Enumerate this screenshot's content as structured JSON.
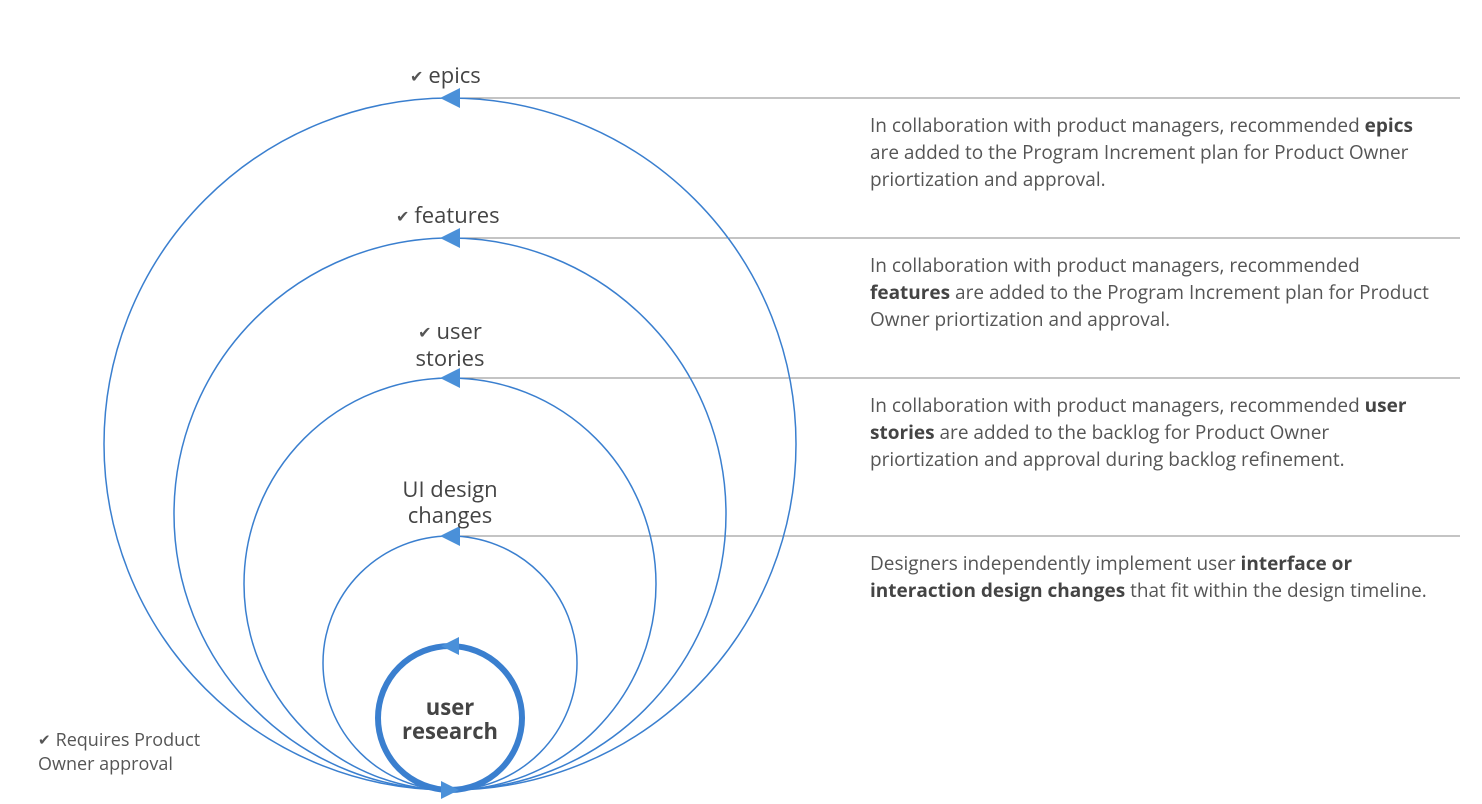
{
  "center": {
    "label_line1": "user",
    "label_line2": "research"
  },
  "rings": {
    "ui": {
      "has_check": false,
      "label_line1": "UI design",
      "label_line2": "changes"
    },
    "stories": {
      "has_check": true,
      "label_line1": "user",
      "label_line2": "stories"
    },
    "features": {
      "has_check": true,
      "label_line1": "features",
      "label_line2": ""
    },
    "epics": {
      "has_check": true,
      "label_line1": "epics",
      "label_line2": ""
    }
  },
  "descriptions": {
    "epics": {
      "pre": "In collaboration with product managers, recommended ",
      "bold": "epics",
      "post": " are added to the Program Increment plan for Product Owner priortization and approval."
    },
    "features": {
      "pre": "In collaboration with product managers, recommended ",
      "bold": "features",
      "post": " are added to the Program Increment plan for Product Owner priortization and approval."
    },
    "stories": {
      "pre": "In collaboration with product managers, recommended ",
      "bold": "user stories",
      "post": " are added to the backlog for Product Owner priortization and approval during backlog refinement."
    },
    "ui": {
      "pre": "Designers independently implement user ",
      "bold": "interface or interaction design changes",
      "post": "  that fit within the design timeline."
    }
  },
  "legend": {
    "text": "Requires Product Owner approval"
  },
  "check_glyph": "✔"
}
